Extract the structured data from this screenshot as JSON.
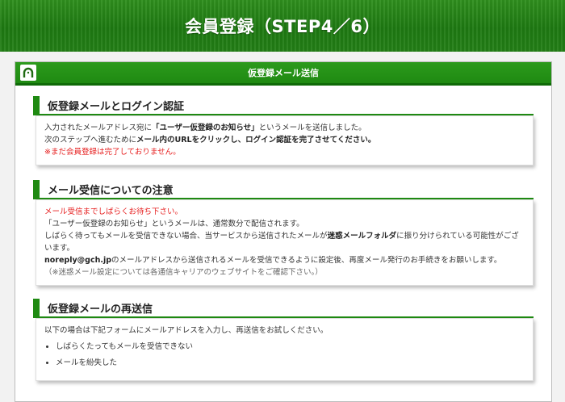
{
  "header": {
    "title": "会員登録（STEP4／6）"
  },
  "panel": {
    "title": "仮登録メール送信"
  },
  "section1": {
    "title": "仮登録メールとログイン認証",
    "line1_a": "入力されたメールアドレス宛に",
    "line1_b": "「ユーザー仮登録のお知らせ」",
    "line1_c": "というメールを送信しました。",
    "line2_a": "次のステップへ進むために",
    "line2_b": "メール内のURLをクリックし、ログイン認証を完了させてください。",
    "line3": "※まだ会員登録は完了しておりません。"
  },
  "section2": {
    "title": "メール受信についての注意",
    "line1": "メール受信までしばらくお待ち下さい。",
    "line2": "「ユーザー仮登録のお知らせ」というメールは、通常数分で配信されます。",
    "line3_a": "しばらく待ってもメールを受信できない場合、当サービスから送信されたメールが",
    "line3_b": "迷惑メールフォルダ",
    "line3_c": "に振り分けられている可能性がございます。",
    "line4_a": "noreply@gch.jp",
    "line4_b": "のメールアドレスから送信されるメールを受信できるように設定後、再度メール発行のお手続きをお願いします。",
    "line5": "（※迷惑メール設定については各通信キャリアのウェブサイトをご確認下さい。）"
  },
  "section3": {
    "title": "仮登録メールの再送信",
    "intro": "以下の場合は下記フォームにメールアドレスを入力し、再送信をお試しください。",
    "items": [
      "しばらくたってもメールを受信できない",
      "メールを紛失した"
    ]
  },
  "colors": {
    "brand_green": "#1f8a12",
    "alert_red": "#e61c1c"
  },
  "icons": {
    "panel_logo": "horseshoe-logo-icon"
  }
}
